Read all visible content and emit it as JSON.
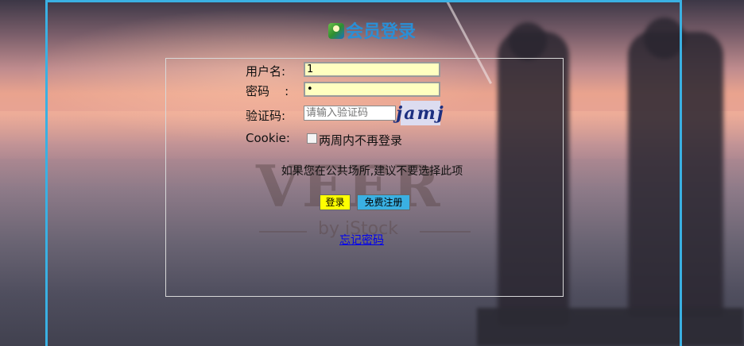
{
  "title": "会员登录",
  "watermark": {
    "main": "VEER",
    "sub": "by iStock"
  },
  "form": {
    "username_label": "用户名:",
    "username_value": "1",
    "password_label": "密码    :",
    "password_value": "1",
    "captcha_label": "验证码:",
    "captcha_placeholder": "请输入验证码",
    "captcha_image_text": "jamj",
    "cookie_label": "Cookie:",
    "remember_label": "两周内不再登录",
    "hint": "如果您在公共场所,建议不要选择此项",
    "login_button": "登录",
    "register_button": "免费注册",
    "forgot_link": "忘记密码"
  },
  "colors": {
    "frame": "#3ab0e2",
    "login_button": "#ffff00",
    "register_button": "#3ab0e2",
    "input_bg": "#ffffc0"
  }
}
